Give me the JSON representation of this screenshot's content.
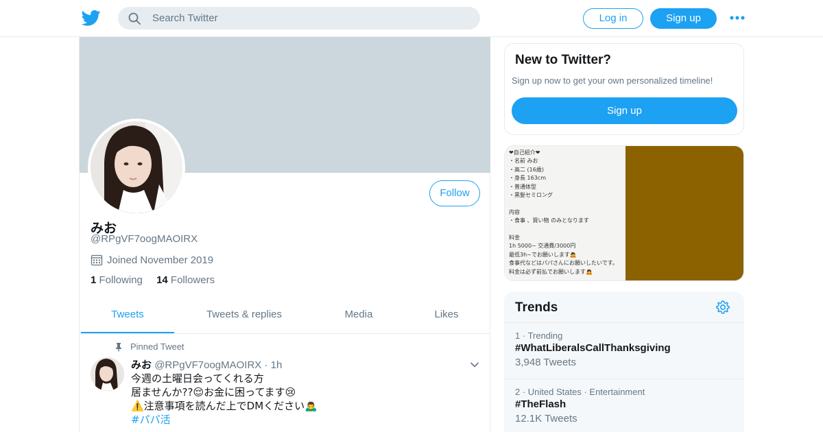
{
  "topbar": {
    "search_placeholder": "Search Twitter",
    "login_label": "Log in",
    "signup_label": "Sign up",
    "more_icon": "more-dots-icon",
    "brand_color": "#1da1f2"
  },
  "profile": {
    "name": "みお",
    "handle": "@RPgVF7oogMAOIRX",
    "joined": "Joined November 2019",
    "following_count": "1",
    "following_label": "Following",
    "followers_count": "14",
    "followers_label": "Followers",
    "follow_label": "Follow",
    "banner_color": "#ccd6dd"
  },
  "tabs": [
    {
      "label": "Tweets",
      "active": true
    },
    {
      "label": "Tweets & replies",
      "active": false
    },
    {
      "label": "Media",
      "active": false
    },
    {
      "label": "Likes",
      "active": false
    }
  ],
  "tweet": {
    "pinned_label": "Pinned Tweet",
    "name": "みお",
    "handle": "@RPgVF7oogMAOIRX",
    "time": "1h",
    "lines": [
      "今週の土曜日会ってくれる方",
      "居ませんか??😌お金に困ってます😢",
      "⚠️注意事項を読んだ上でDMください🙇‍♂️"
    ],
    "hashtag": "#パパ活"
  },
  "sidebar": {
    "new_title": "New to Twitter?",
    "new_text": "Sign up now to get your own personalized timeline!",
    "new_signup": "Sign up",
    "media_lines": [
      "❤自己紹介❤",
      "・名前 みお",
      "・高二 (16歳)",
      "・身長 163cm",
      "・普通体型",
      "・黒髪セミロング",
      "",
      "内容",
      "・食事 、買い物 のみとなります",
      "",
      "料金",
      "1h 5000~ 交通費/3000円",
      "最低3h~でお願いします🙇",
      "食事代などはパパさんにお願いしたいです。",
      "料金は必ず前払でお願いします🙇"
    ],
    "trends_title": "Trends",
    "trends": [
      {
        "rank": "1",
        "context": "Trending",
        "name": "#WhatLiberalsCallThanksgiving",
        "count": "3,948 Tweets"
      },
      {
        "rank": "2",
        "context": "United States · Entertainment",
        "name": "#TheFlash",
        "count": "12.1K Tweets"
      }
    ]
  }
}
